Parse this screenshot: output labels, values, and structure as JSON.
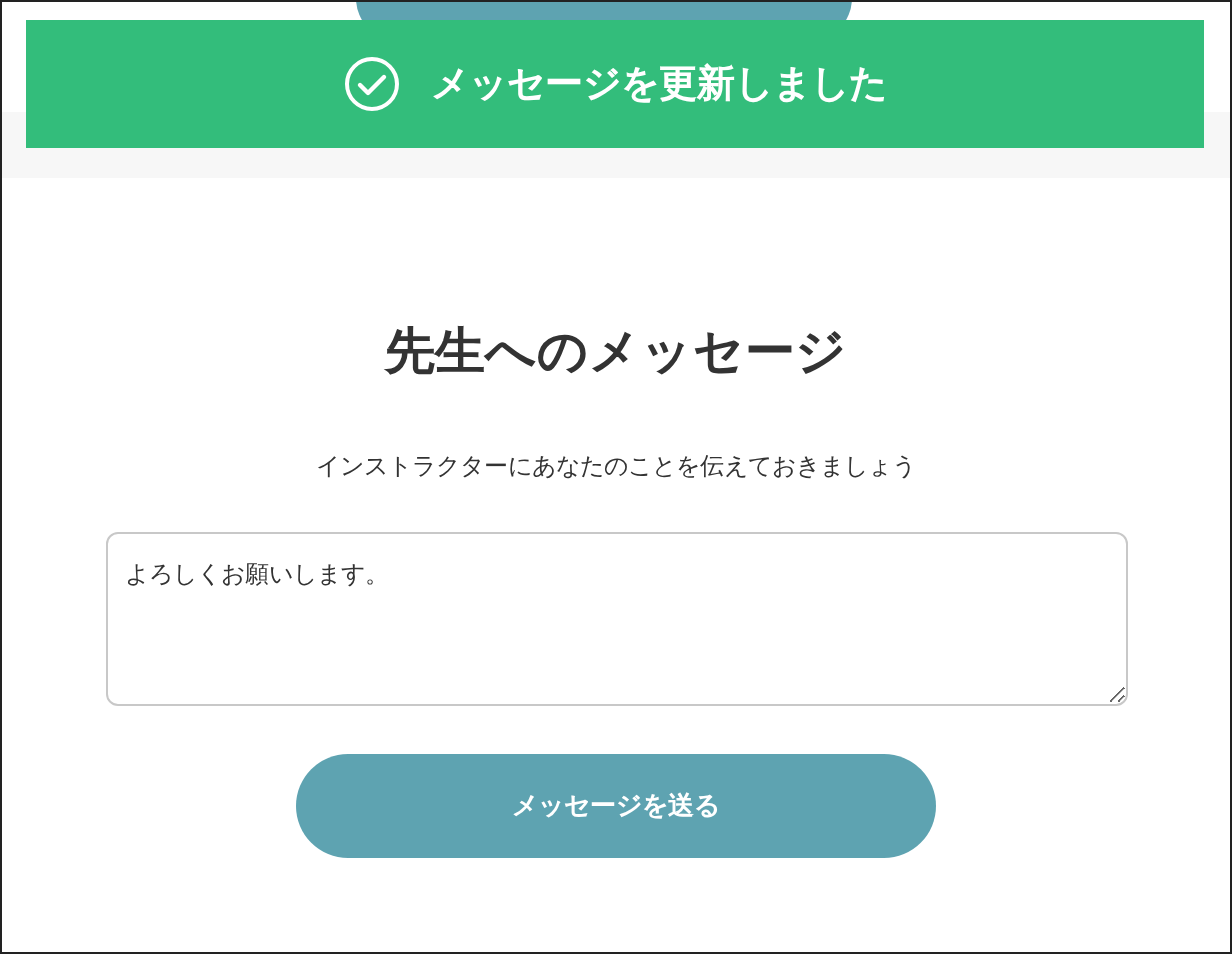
{
  "toast": {
    "message": "メッセージを更新しました"
  },
  "title": "先生へのメッセージ",
  "subtitle": "インストラクターにあなたのことを伝えておきましょう",
  "message_field": {
    "value": "よろしくお願いします。"
  },
  "send_button": {
    "label": "メッセージを送る"
  }
}
